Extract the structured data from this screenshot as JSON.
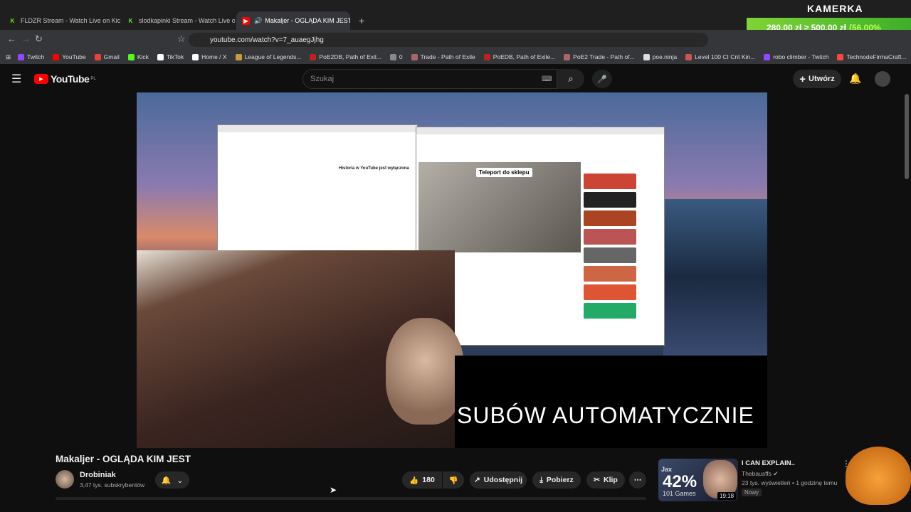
{
  "browser": {
    "tabs": [
      {
        "label": "FLDZR Stream - Watch Live on Kick",
        "icon": "kick-icon",
        "color": "#53fc18"
      },
      {
        "label": "slodkapinki Stream - Watch Live on Ki",
        "icon": "kick-icon",
        "color": "#53fc18"
      },
      {
        "label": "Makaljer - OGLĄDA KIM JEST",
        "icon": "youtube-icon",
        "color": "#ff0000",
        "active": true
      }
    ],
    "url": "youtube.com/watch?v=7_auaegJjhg",
    "bookmarks": [
      {
        "label": "Twitch",
        "color": "#9146ff"
      },
      {
        "label": "YouTube",
        "color": "#ff0000"
      },
      {
        "label": "Gmail",
        "color": "#ea4335"
      },
      {
        "label": "Kick",
        "color": "#53fc18"
      },
      {
        "label": "TikTok",
        "color": "#ffffff"
      },
      {
        "label": "Home / X",
        "color": "#ffffff"
      },
      {
        "label": "League of Legends...",
        "color": "#c89b3c"
      },
      {
        "label": "PoE2DB, Path of Exil...",
        "color": "#b22"
      },
      {
        "label": "0",
        "color": "#888"
      },
      {
        "label": "Trade - Path of Exile",
        "color": "#a66"
      },
      {
        "label": "PoEDB, Path of Exile...",
        "color": "#b22"
      },
      {
        "label": "PoE2 Trade - Path of...",
        "color": "#a66"
      },
      {
        "label": "poe.ninja",
        "color": "#ddd"
      },
      {
        "label": "Level 100 CI Crit Kin...",
        "color": "#c55"
      },
      {
        "label": "robo climber - Twitch",
        "color": "#9146ff"
      },
      {
        "label": "TechnodeFirmaCraft...",
        "color": "#f44"
      }
    ]
  },
  "overlay": {
    "kamerka": "KAMERKA",
    "donation": "280,00 zł ≥ 500,00 zł",
    "donation_pct": "(56.00%"
  },
  "youtube": {
    "logo": "YouTube",
    "region": "PL",
    "search_placeholder": "Szukaj",
    "create": "Utwórz"
  },
  "video": {
    "subtitle": "SUBÓW AUTOMATYCZNIE",
    "teleport": "Teleport do sklepu"
  },
  "meta": {
    "title": "Makaljer - OGLĄDA KIM JEST",
    "channel": "Drobiniak",
    "subscribers": "3,47 tys. subskrybentów",
    "likes": "180",
    "share": "Udostępnij",
    "download": "Pobierz",
    "clip": "Klip"
  },
  "recommended": {
    "title": "I CAN EXPLAIN..",
    "channel": "Thebausffs",
    "views": "23 tys. wyświetleń • 1 godzinę temu",
    "badge": "Nowy",
    "duration": "19:18",
    "champ": "Jax",
    "percent": "42%",
    "games": "101 Games"
  }
}
